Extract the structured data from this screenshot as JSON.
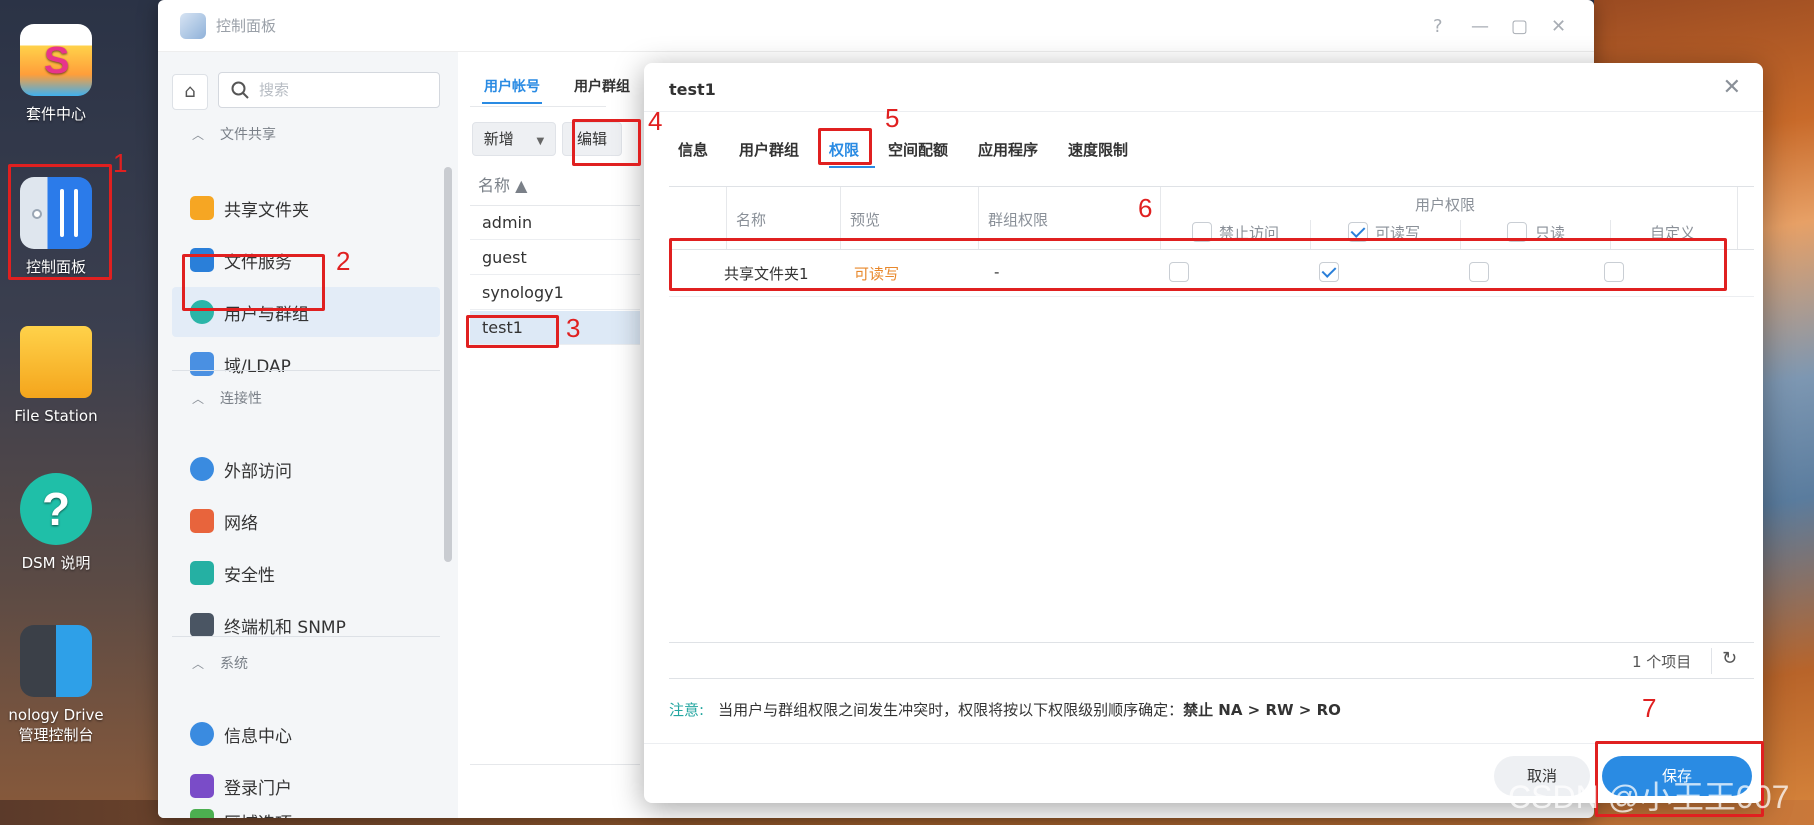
{
  "desktop": {
    "icons": [
      {
        "name": "package-center",
        "label": "套件中心"
      },
      {
        "name": "control-panel",
        "label": "控制面板"
      },
      {
        "name": "file-station",
        "label": "File Station"
      },
      {
        "name": "dsm-help",
        "label": "DSM 说明"
      },
      {
        "name": "synology-drive",
        "label": "nology Drive 管理控制台"
      }
    ],
    "annotations": [
      "1",
      "2",
      "3",
      "4",
      "5",
      "6",
      "7"
    ],
    "watermark": "CSDN @小王王007"
  },
  "window": {
    "title": "控制面板",
    "controls": [
      "?",
      "—",
      "▢",
      "✕"
    ]
  },
  "sidebar": {
    "search_placeholder": "搜索",
    "sections": [
      {
        "title": "文件共享",
        "items": [
          "共享文件夹",
          "文件服务",
          "用户与群组",
          "域/LDAP"
        ]
      },
      {
        "title": "连接性",
        "items": [
          "外部访问",
          "网络",
          "安全性",
          "终端机和 SNMP"
        ]
      },
      {
        "title": "系统",
        "items": [
          "信息中心",
          "登录门户",
          "区域选项"
        ]
      }
    ],
    "active_item": "用户与群组"
  },
  "main": {
    "tabs": [
      "用户帐号",
      "用户群组"
    ],
    "buttons": {
      "add": "新增",
      "edit": "编辑"
    },
    "list_header": "名称 ▲",
    "users": [
      "admin",
      "guest",
      "synology1",
      "test1"
    ],
    "selected_user": "test1"
  },
  "dialog": {
    "title": "test1",
    "tabs": [
      "信息",
      "用户群组",
      "权限",
      "空间配额",
      "应用程序",
      "速度限制"
    ],
    "active_tab": "权限",
    "columns": {
      "name": "名称",
      "preview": "预览",
      "group_perm": "群组权限",
      "user_perm": "用户权限",
      "deny": "禁止访问",
      "rw": "可读写",
      "ro": "只读",
      "custom": "自定义"
    },
    "rows": [
      {
        "name": "共享文件夹1",
        "preview": "可读写",
        "group": "-",
        "deny": false,
        "rw": true,
        "ro": false,
        "custom": false
      }
    ],
    "preview_color": "#e8882b",
    "item_count": "1 个项目",
    "note_label": "注意:",
    "note_text": "当用户与群组权限之间发生冲突时，权限将按以下权限级别顺序确定：",
    "note_order": "禁止 NA > RW > RO",
    "cancel": "取消",
    "save": "保存"
  }
}
